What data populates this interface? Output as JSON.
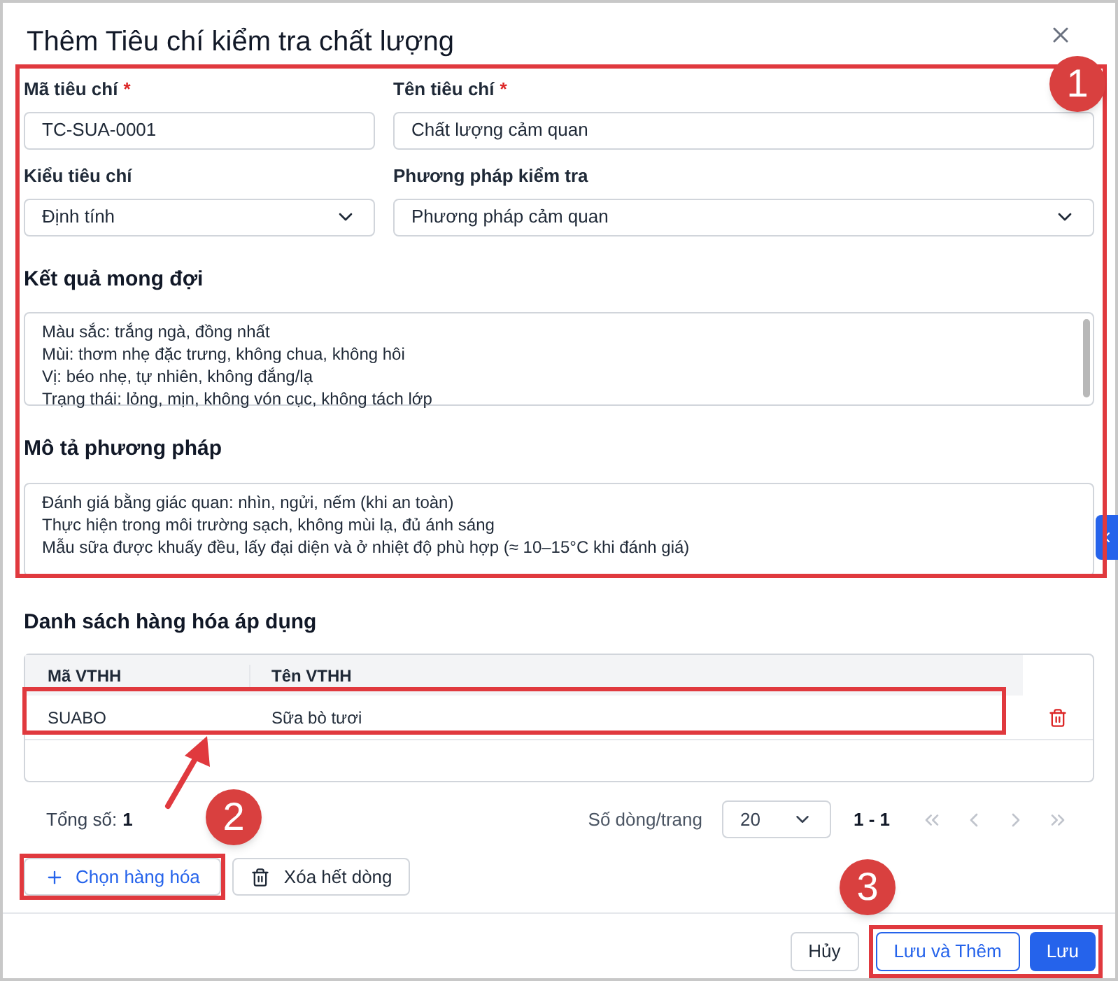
{
  "dialog": {
    "title": "Thêm Tiêu chí kiểm tra chất lượng"
  },
  "fields": [
    {
      "kind": "input",
      "label": "Mã tiêu chí",
      "required": true,
      "value": "TC-SUA-0001"
    },
    {
      "kind": "input",
      "label": "Tên tiêu chí",
      "required": true,
      "value": "Chất lượng cảm quan"
    },
    {
      "kind": "select",
      "label": "Kiểu tiêu chí",
      "required": false,
      "value": "Định tính"
    },
    {
      "kind": "select",
      "label": "Phương pháp kiểm tra",
      "required": false,
      "value": "Phương pháp cảm quan"
    }
  ],
  "required_mark": "*",
  "textareas": [
    {
      "label": "Kết quả mong đợi",
      "lines": [
        "Màu sắc: trắng ngà, đồng nhất",
        "Mùi: thơm nhẹ đặc trưng, không chua, không hôi",
        "Vị: béo nhẹ, tự nhiên, không đắng/lạ",
        "Trạng thái: lỏng, mịn, không vón cục, không tách lớp"
      ],
      "scrollbar": true
    },
    {
      "label": "Mô tả phương pháp",
      "lines": [
        "Đánh giá bằng giác quan: nhìn, ngửi, nếm (khi an toàn)",
        "Thực hiện trong môi trường sạch, không mùi lạ, đủ ánh sáng",
        "Mẫu sữa được khuấy đều, lấy đại diện và ở nhiệt độ phù hợp (≈ 10–15°C khi đánh giá)"
      ],
      "scrollbar": false
    }
  ],
  "goods": {
    "title": "Danh sách hàng hóa áp dụng",
    "columns": [
      "Mã VTHH",
      "Tên VTHH"
    ],
    "rows": [
      {
        "cells": [
          "SUABO",
          "Sữa bò tươi"
        ]
      }
    ],
    "total_label": "Tổng số:",
    "total": "1",
    "page_size_label": "Số dòng/trang",
    "page_size": "20",
    "range": "1 - 1",
    "add_button": "Chọn hàng hóa",
    "clear_button": "Xóa hết dòng"
  },
  "footer": {
    "cancel": "Hủy",
    "save_add": "Lưu và Thêm",
    "save": "Lưu"
  },
  "annotations": [
    "1",
    "2",
    "3"
  ]
}
